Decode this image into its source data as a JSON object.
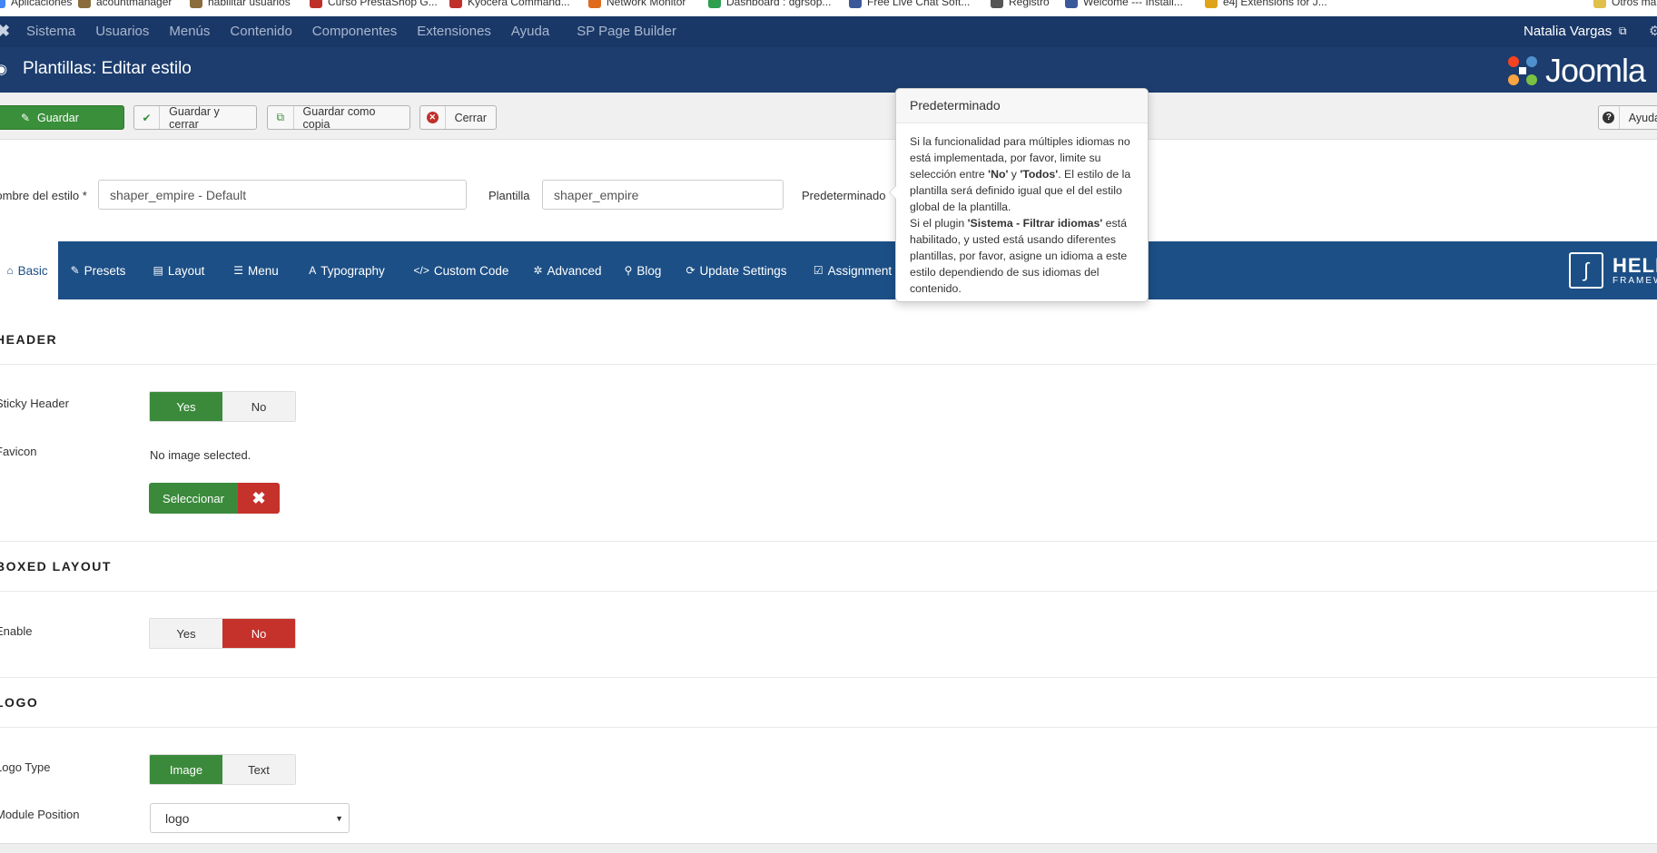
{
  "bookmarks": [
    {
      "label": "Aplicaciones",
      "color": "#4285f4"
    },
    {
      "label": "acountmanager",
      "color": "#8a6d3b"
    },
    {
      "label": "habilitar usuarios",
      "color": "#8a6d3b"
    },
    {
      "label": "Curso PrestaShop G...",
      "color": "#c0302b"
    },
    {
      "label": "Kyocera Command...",
      "color": "#c0302b"
    },
    {
      "label": "Network Monitor",
      "color": "#e06a1b"
    },
    {
      "label": "Dashboard : dgrsop...",
      "color": "#2e9e4f"
    },
    {
      "label": "Free Live Chat Soft...",
      "color": "#3b5998"
    },
    {
      "label": "Registro",
      "color": "#555555"
    },
    {
      "label": "Welcome --- Install...",
      "color": "#3b5998"
    },
    {
      "label": "e4j Extensions for J...",
      "color": "#e0a41b"
    },
    {
      "label": "Otros ma",
      "color": "#e0c04b"
    }
  ],
  "topnav": {
    "items": [
      "Sistema",
      "Usuarios",
      "Menús",
      "Contenido",
      "Componentes",
      "Extensiones",
      "Ayuda",
      "SP Page Builder"
    ],
    "user": "Natalia Vargas"
  },
  "title": "Plantillas: Editar estilo",
  "logo_text": "Joomla",
  "toolbar": {
    "save": "Guardar",
    "save_close": "Guardar y cerrar",
    "save_copy": "Guardar como copia",
    "close": "Cerrar",
    "help": "Ayuda"
  },
  "form": {
    "style_name_label": "Nombre del estilo *",
    "style_name_value": "shaper_empire - Default",
    "template_label": "Plantilla",
    "template_value": "shaper_empire",
    "default_label": "Predeterminado"
  },
  "tabs": [
    {
      "label": "Basic",
      "icon": "home-icon",
      "glyph": "⌂"
    },
    {
      "label": "Presets",
      "icon": "brush-icon",
      "glyph": "✎"
    },
    {
      "label": "Layout",
      "icon": "layout-icon",
      "glyph": "▤"
    },
    {
      "label": "Menu",
      "icon": "list-icon",
      "glyph": "☰"
    },
    {
      "label": "Typography",
      "icon": "font-icon",
      "glyph": "A"
    },
    {
      "label": "Custom Code",
      "icon": "code-icon",
      "glyph": "</>"
    },
    {
      "label": "Advanced",
      "icon": "gear-icon",
      "glyph": "✲"
    },
    {
      "label": "Blog",
      "icon": "pin-icon",
      "glyph": "⚲"
    },
    {
      "label": "Update Settings",
      "icon": "refresh-icon",
      "glyph": "⟳"
    },
    {
      "label": "Assignment",
      "icon": "check-square-icon",
      "glyph": "☑"
    }
  ],
  "helix": {
    "name": "HELIX",
    "sub": "FRAMEWORK"
  },
  "sections": {
    "header": {
      "title": "HEADER",
      "sticky_label": "Sticky Header",
      "favicon_label": "Favicon",
      "no_image": "No image selected.",
      "select": "Seleccionar"
    },
    "boxed": {
      "title": "BOXED LAYOUT",
      "enable_label": "Enable"
    },
    "logo": {
      "title": "LOGO",
      "logo_type_label": "Logo Type",
      "module_position_label": "Module Position",
      "module_position_value": "logo"
    }
  },
  "toggles": {
    "yes": "Yes",
    "no": "No",
    "image": "Image",
    "text": "Text"
  },
  "popover": {
    "title": "Predeterminado",
    "p1": "Si la funcionalidad para múltiples idiomas no está implementada, por favor, limite su selección entre ",
    "b1": "'No'",
    "p1b": " y ",
    "b2": "'Todos'",
    "p1c": ". El estilo de la plantilla será definido igual que el del estilo global de la plantilla.",
    "p2": "Si el plugin ",
    "b3": "'Sistema - Filtrar idiomas'",
    "p2b": " está habilitado, y usted está usando diferentes plantillas, por favor, asigne un idioma a este estilo dependiendo de sus idiomas del contenido."
  },
  "colors": {
    "nav": "#1a3867",
    "tabs": "#1c4f86",
    "green": "#3b8a3b",
    "red": "#c5312b"
  }
}
